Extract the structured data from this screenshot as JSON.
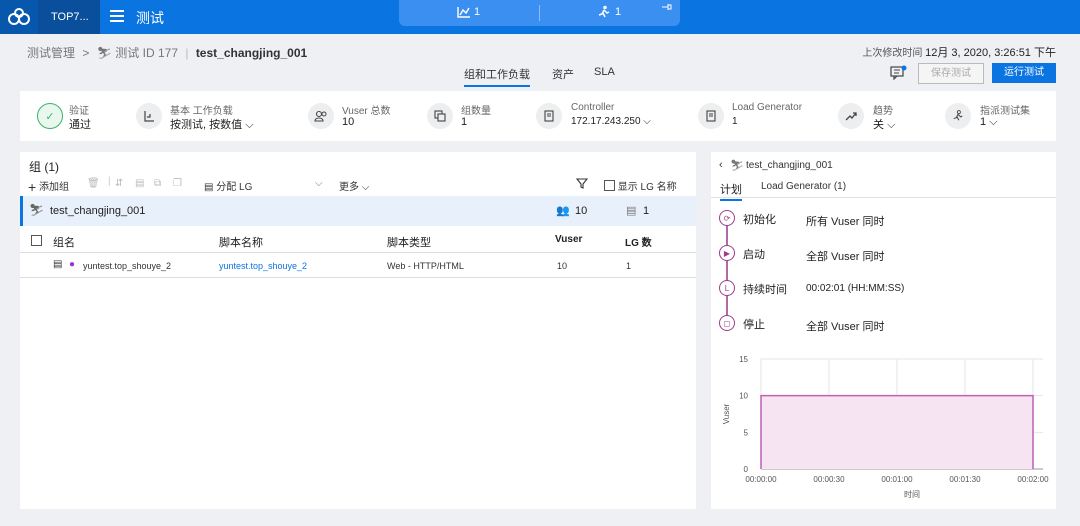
{
  "topbar": {
    "project": "TOP7...",
    "app_title": "测试",
    "pill_left_count": "1",
    "pill_right_count": "1"
  },
  "header": {
    "crumb_root": "测试管理",
    "crumb_test": "测试 ID 177",
    "test_name": "test_changjing_001",
    "last_modified_label": "上次修改时间",
    "last_modified_value": "12月 3, 2020, 3:26:51 下午",
    "tabs": [
      "组和工作负载",
      "资产",
      "SLA"
    ],
    "save_label": "保存测试",
    "run_label": "运行测试"
  },
  "summary": {
    "validate_label": "验证",
    "validate_value": "通过",
    "workload_label": "基本 工作负载",
    "workload_value": "按测试, 按数值",
    "vuser_label": "Vuser 总数",
    "vuser_value": "10",
    "group_label": "组数量",
    "group_value": "1",
    "controller_label": "Controller",
    "controller_value": "172.17.243.250",
    "lg_label": "Load Generator",
    "lg_value": "1",
    "trend_label": "趋势",
    "trend_value": "关",
    "assign_label": "指派测试集",
    "assign_value": "1"
  },
  "groups": {
    "title": "组 (1)",
    "add_label": "添加组",
    "assign_lg_label": "分配 LG",
    "more_label": "更多",
    "show_lg_label": "显示 LG 名称",
    "group_name": "test_changjing_001",
    "group_vusers": "10",
    "group_lgs": "1",
    "columns": [
      "组名",
      "脚本名称",
      "脚本类型",
      "Vuser",
      "LG 数"
    ],
    "rows": [
      {
        "name": "yuntest.top_shouye_2",
        "script": "yuntest.top_shouye_2",
        "type": "Web - HTTP/HTML",
        "vuser": "10",
        "lg": "1"
      }
    ]
  },
  "schedule": {
    "back_title": "test_changjing_001",
    "tabs": [
      "计划",
      "Load Generator (1)"
    ],
    "steps": [
      {
        "label": "初始化",
        "value": "所有 Vuser 同时"
      },
      {
        "label": "启动",
        "value": "全部 Vuser 同时"
      },
      {
        "label": "持续时间",
        "value": "00:02:01 (HH:MM:SS)"
      },
      {
        "label": "停止",
        "value": "全部 Vuser 同时"
      }
    ]
  },
  "colors": {
    "accent": "#0a74e0",
    "step": "#9c3d8c",
    "chart_line": "#c25fb4",
    "chart_fill": "#f6e4f2",
    "valid": "#38b46a"
  },
  "chart_data": {
    "type": "area",
    "x": [
      "00:00:00",
      "00:00:00",
      "00:02:00",
      "00:02:00"
    ],
    "x_seconds": [
      0,
      0,
      120,
      120
    ],
    "y": [
      0,
      10,
      10,
      0
    ],
    "xticks": [
      "00:00:00",
      "00:00:30",
      "00:01:00",
      "00:01:30",
      "00:02:00"
    ],
    "yticks": [
      "0",
      "5",
      "10",
      "15"
    ],
    "xlabel": "时间",
    "ylabel": "Vuser",
    "ylim": [
      0,
      15
    ],
    "xlim_seconds": [
      0,
      120
    ],
    "grid": true
  }
}
